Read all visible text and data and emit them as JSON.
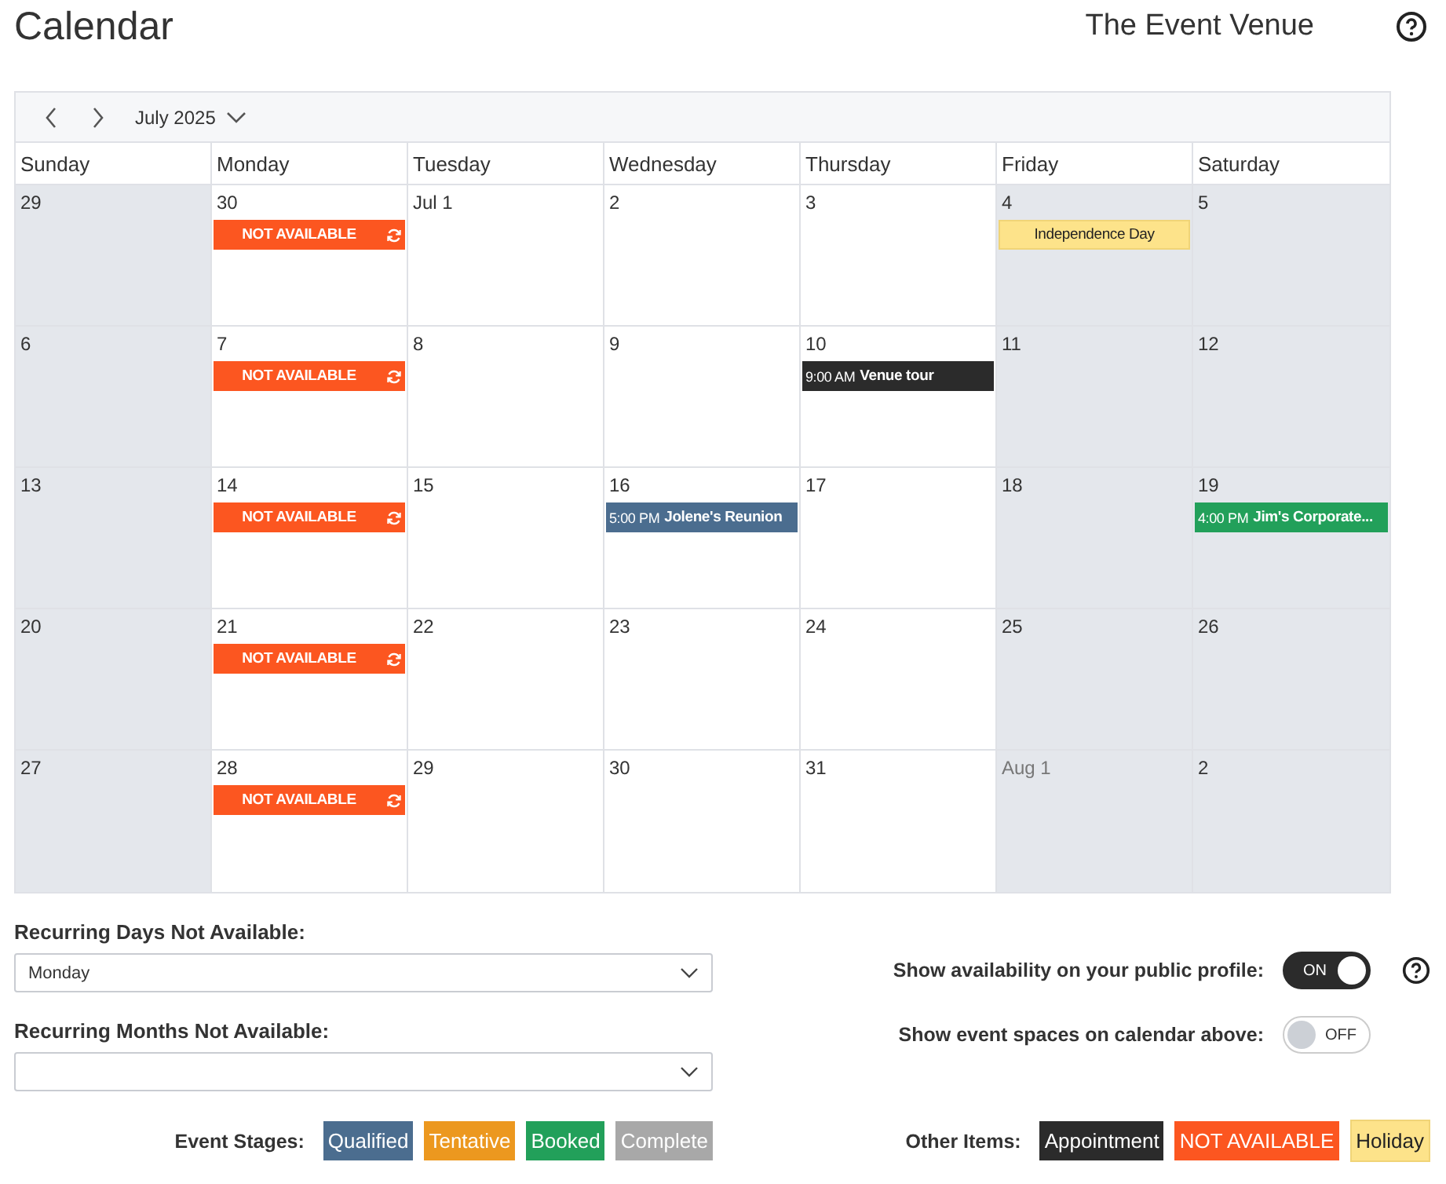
{
  "header": {
    "title": "Calendar",
    "venue": "The Event Venue"
  },
  "toolbar": {
    "month": "July 2025"
  },
  "weekdays": [
    "Sunday",
    "Monday",
    "Tuesday",
    "Wednesday",
    "Thursday",
    "Friday",
    "Saturday"
  ],
  "days": [
    {
      "date": "29",
      "faded": false,
      "shaded": true
    },
    {
      "date": "30",
      "faded": false,
      "shaded": false,
      "events": [
        {
          "kind": "unavailable",
          "title": "NOT AVAILABLE",
          "recurring": true
        }
      ]
    },
    {
      "date": "Jul 1",
      "faded": false,
      "shaded": false
    },
    {
      "date": "2",
      "faded": false,
      "shaded": false
    },
    {
      "date": "3",
      "faded": false,
      "shaded": false
    },
    {
      "date": "4",
      "faded": false,
      "shaded": true,
      "events": [
        {
          "kind": "holiday",
          "title": "Independence Day",
          "recurring": false
        }
      ]
    },
    {
      "date": "5",
      "faded": false,
      "shaded": true
    },
    {
      "date": "6",
      "faded": false,
      "shaded": true
    },
    {
      "date": "7",
      "faded": false,
      "shaded": false,
      "events": [
        {
          "kind": "unavailable",
          "title": "NOT AVAILABLE",
          "recurring": true
        }
      ]
    },
    {
      "date": "8",
      "faded": false,
      "shaded": false
    },
    {
      "date": "9",
      "faded": false,
      "shaded": false
    },
    {
      "date": "10",
      "faded": false,
      "shaded": false,
      "events": [
        {
          "kind": "appointment",
          "time": "9:00 AM",
          "title": "Venue tour",
          "recurring": false
        }
      ]
    },
    {
      "date": "11",
      "faded": false,
      "shaded": true
    },
    {
      "date": "12",
      "faded": false,
      "shaded": true
    },
    {
      "date": "13",
      "faded": false,
      "shaded": true
    },
    {
      "date": "14",
      "faded": false,
      "shaded": false,
      "events": [
        {
          "kind": "unavailable",
          "title": "NOT AVAILABLE",
          "recurring": true
        }
      ]
    },
    {
      "date": "15",
      "faded": false,
      "shaded": false
    },
    {
      "date": "16",
      "faded": false,
      "shaded": false,
      "events": [
        {
          "kind": "qualified",
          "time": "5:00 PM",
          "title": "Jolene's Reunion",
          "recurring": false
        }
      ]
    },
    {
      "date": "17",
      "faded": false,
      "shaded": false
    },
    {
      "date": "18",
      "faded": false,
      "shaded": true
    },
    {
      "date": "19",
      "faded": false,
      "shaded": true,
      "events": [
        {
          "kind": "booked",
          "time": "4:00 PM",
          "title": "Jim's Corporate...",
          "recurring": false
        }
      ]
    },
    {
      "date": "20",
      "faded": false,
      "shaded": true
    },
    {
      "date": "21",
      "faded": false,
      "shaded": false,
      "events": [
        {
          "kind": "unavailable",
          "title": "NOT AVAILABLE",
          "recurring": true
        }
      ]
    },
    {
      "date": "22",
      "faded": false,
      "shaded": false
    },
    {
      "date": "23",
      "faded": false,
      "shaded": false
    },
    {
      "date": "24",
      "faded": false,
      "shaded": false
    },
    {
      "date": "25",
      "faded": false,
      "shaded": true
    },
    {
      "date": "26",
      "faded": false,
      "shaded": true
    },
    {
      "date": "27",
      "faded": false,
      "shaded": true
    },
    {
      "date": "28",
      "faded": false,
      "shaded": false,
      "events": [
        {
          "kind": "unavailable",
          "title": "NOT AVAILABLE",
          "recurring": true
        }
      ]
    },
    {
      "date": "29",
      "faded": false,
      "shaded": false
    },
    {
      "date": "30",
      "faded": false,
      "shaded": false
    },
    {
      "date": "31",
      "faded": false,
      "shaded": false
    },
    {
      "date": "Aug 1",
      "faded": true,
      "shaded": true
    },
    {
      "date": "2",
      "faded": false,
      "shaded": true
    }
  ],
  "settings": {
    "recurring_days": {
      "label": "Recurring Days Not Available:",
      "value": "Monday"
    },
    "recurring_months": {
      "label": "Recurring Months Not Available:"
    },
    "toggles": [
      {
        "label": "Show availability on your public profile:",
        "state": "ON",
        "on": true,
        "help": true
      },
      {
        "label": "Show event spaces on calendar above:",
        "state": "OFF",
        "on": false,
        "help": false
      }
    ]
  },
  "legend": {
    "stages_label": "Event Stages:",
    "stages": [
      {
        "kind": "qualified",
        "label": "Qualified"
      },
      {
        "kind": "tentative",
        "label": "Tentative"
      },
      {
        "kind": "booked",
        "label": "Booked"
      },
      {
        "kind": "complete",
        "label": "Complete"
      }
    ],
    "other_label": "Other Items:",
    "other": [
      {
        "kind": "appointment",
        "label": "Appointment"
      },
      {
        "kind": "unavailable",
        "label": "NOT AVAILABLE"
      },
      {
        "kind": "holiday",
        "label": "Holiday"
      }
    ]
  }
}
